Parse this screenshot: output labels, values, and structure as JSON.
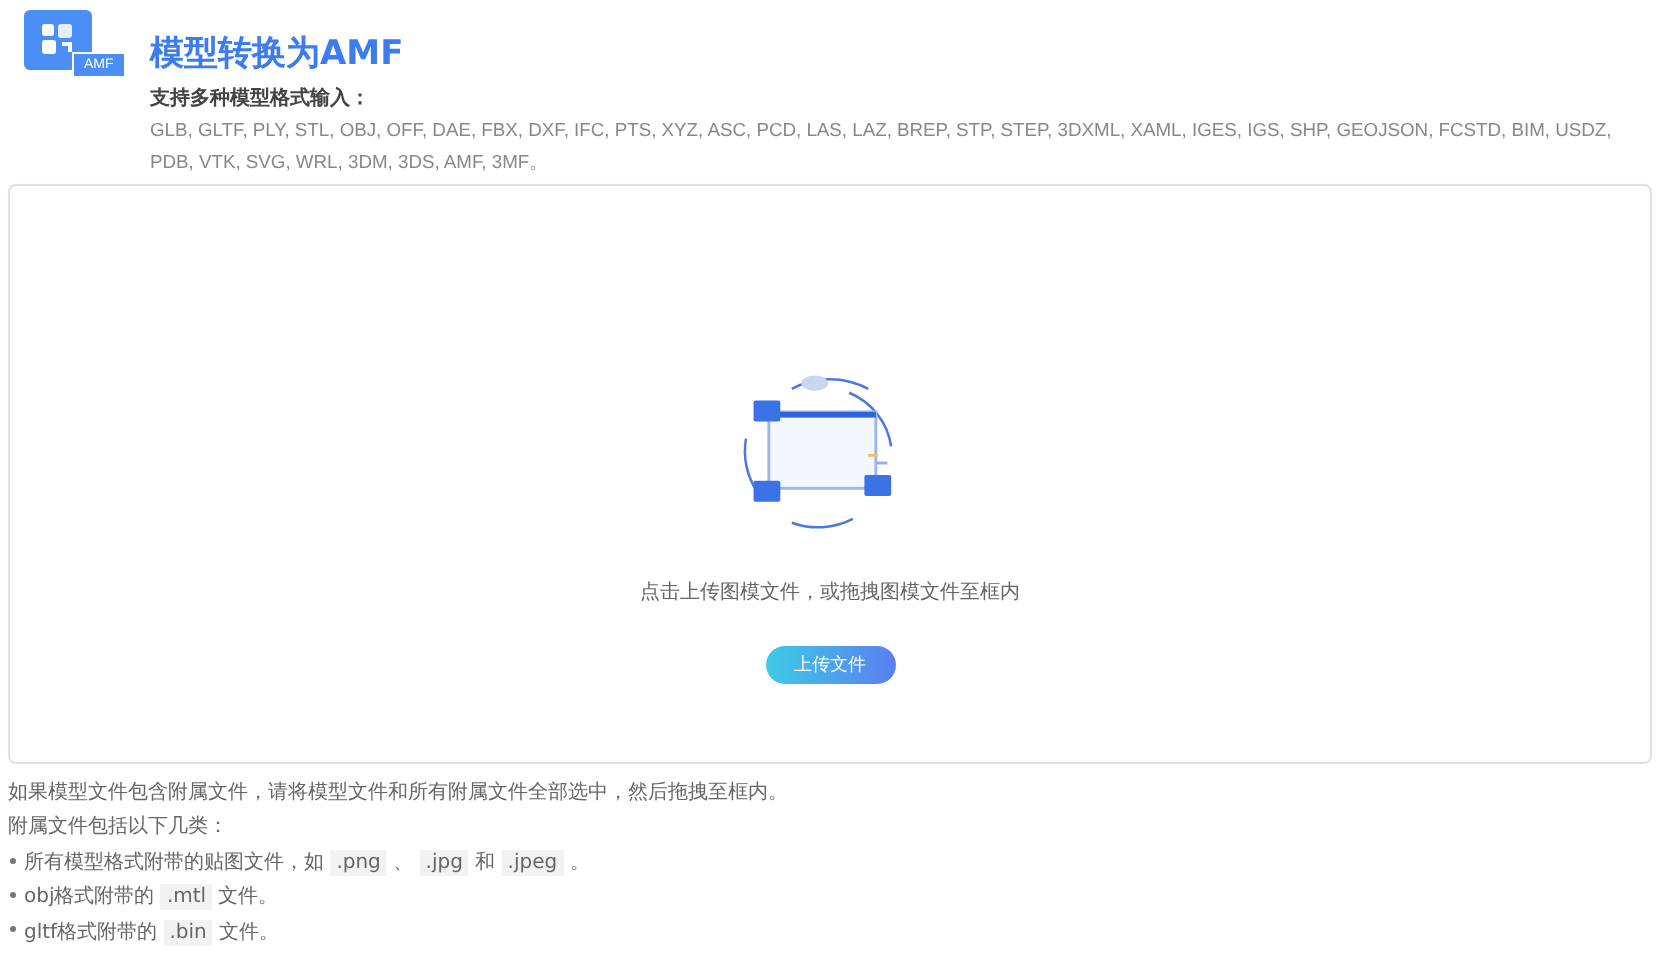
{
  "header": {
    "logo_badge": "AMF",
    "title": "模型转换为AMF",
    "subtitle": "支持多种模型格式输入：",
    "formats": "GLB, GLTF, PLY, STL, OBJ, OFF, DAE, FBX, DXF, IFC, PTS, XYZ, ASC, PCD, LAS, LAZ, BREP, STP, STEP, 3DXML, XAML, IGES, IGS, SHP, GEOJSON, FCSTD, BIM, USDZ, PDB, VTK, SVG, WRL, 3DM, 3DS, AMF, 3MF。"
  },
  "dropzone": {
    "hint": "点击上传图模文件，或拖拽图模文件至框内",
    "button": "上传文件"
  },
  "notes": {
    "intro": "如果模型文件包含附属文件，请将模型文件和所有附属文件全部选中，然后拖拽至框内。",
    "heading": "附属文件包括以下几类：",
    "items": [
      [
        {
          "kind": "text",
          "text": "所有模型格式附带的贴图文件，如 "
        },
        {
          "kind": "code",
          "text": ".png"
        },
        {
          "kind": "text",
          "text": " 、 "
        },
        {
          "kind": "code",
          "text": ".jpg"
        },
        {
          "kind": "text",
          "text": " 和 "
        },
        {
          "kind": "code",
          "text": ".jpeg"
        },
        {
          "kind": "text",
          "text": " 。"
        }
      ],
      [
        {
          "kind": "text",
          "text": "obj格式附带的 "
        },
        {
          "kind": "code",
          "text": ".mtl"
        },
        {
          "kind": "text",
          "text": " 文件。"
        }
      ],
      [
        {
          "kind": "text",
          "text": "gltf格式附带的 "
        },
        {
          "kind": "code",
          "text": ".bin"
        },
        {
          "kind": "text",
          "text": " 文件。"
        }
      ]
    ]
  }
}
